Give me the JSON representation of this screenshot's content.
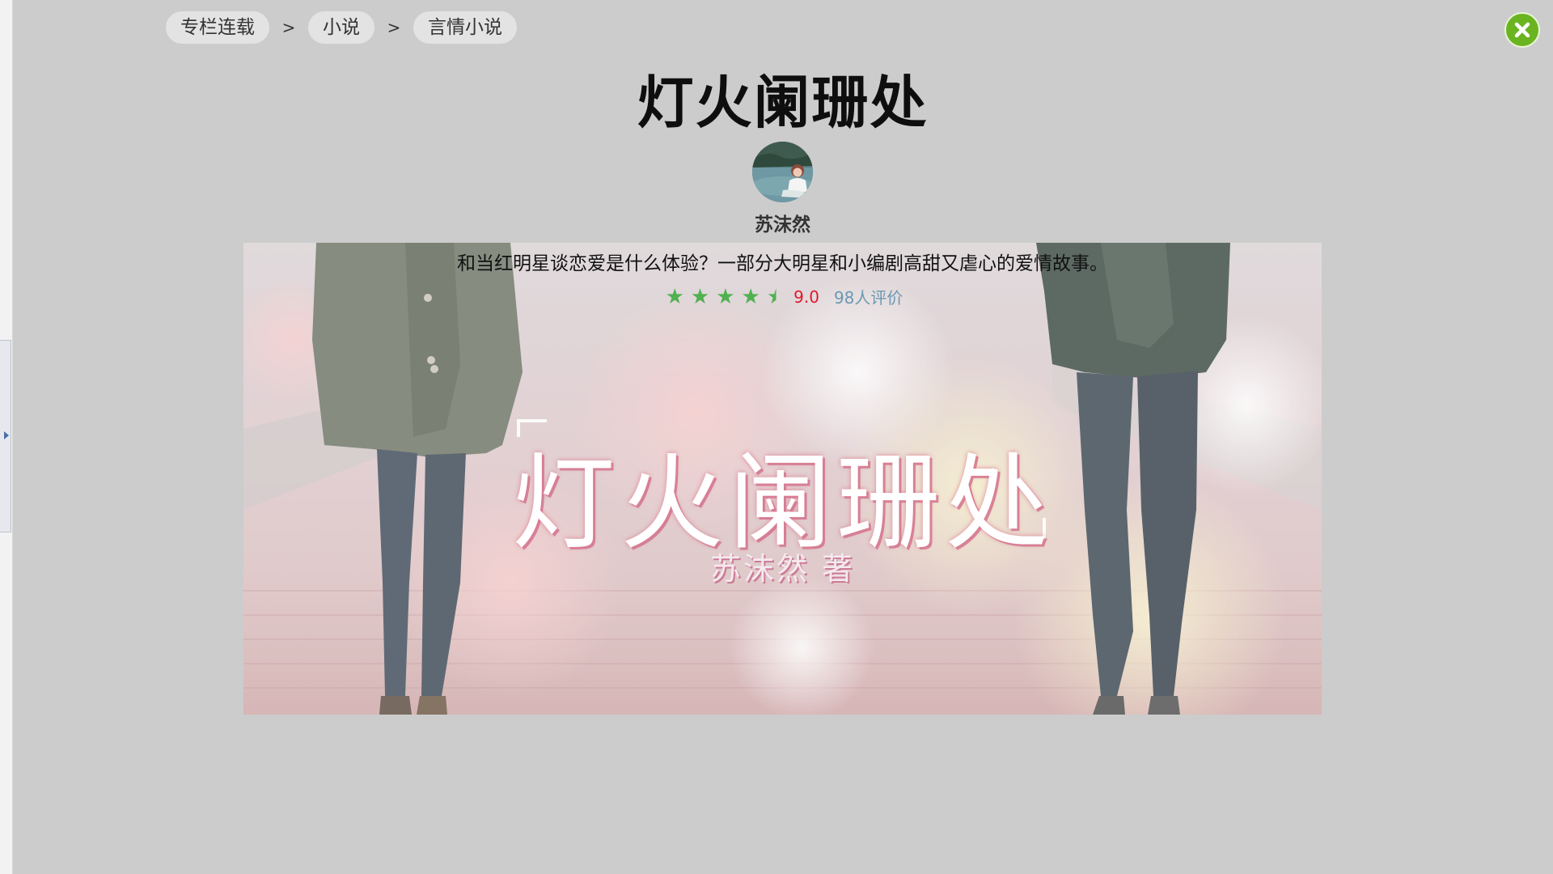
{
  "breadcrumb": {
    "items": [
      "专栏连载",
      "小说",
      "言情小说"
    ],
    "separator": ">"
  },
  "book": {
    "title": "灯火阑珊处",
    "author": "苏沫然",
    "description": "和当红明星谈恋爱是什么体验？一部分大明星和小编剧高甜又虐心的爱情故事。",
    "rating": {
      "stars": 4.5,
      "max_stars": 5,
      "score": "9.0",
      "reviews": "98人评价"
    },
    "cover": {
      "title": "灯火阑珊处",
      "author_line": "苏沫然 著"
    }
  },
  "icons": {
    "close": "close-icon",
    "star": "star-icon",
    "panel_toggle": "chevron-right-icon"
  },
  "colors": {
    "page_bg": "#cccccc",
    "close_button": "#6ab420",
    "star": "#4fb14f",
    "score": "#e0192e",
    "reviews": "#6b98b3"
  }
}
